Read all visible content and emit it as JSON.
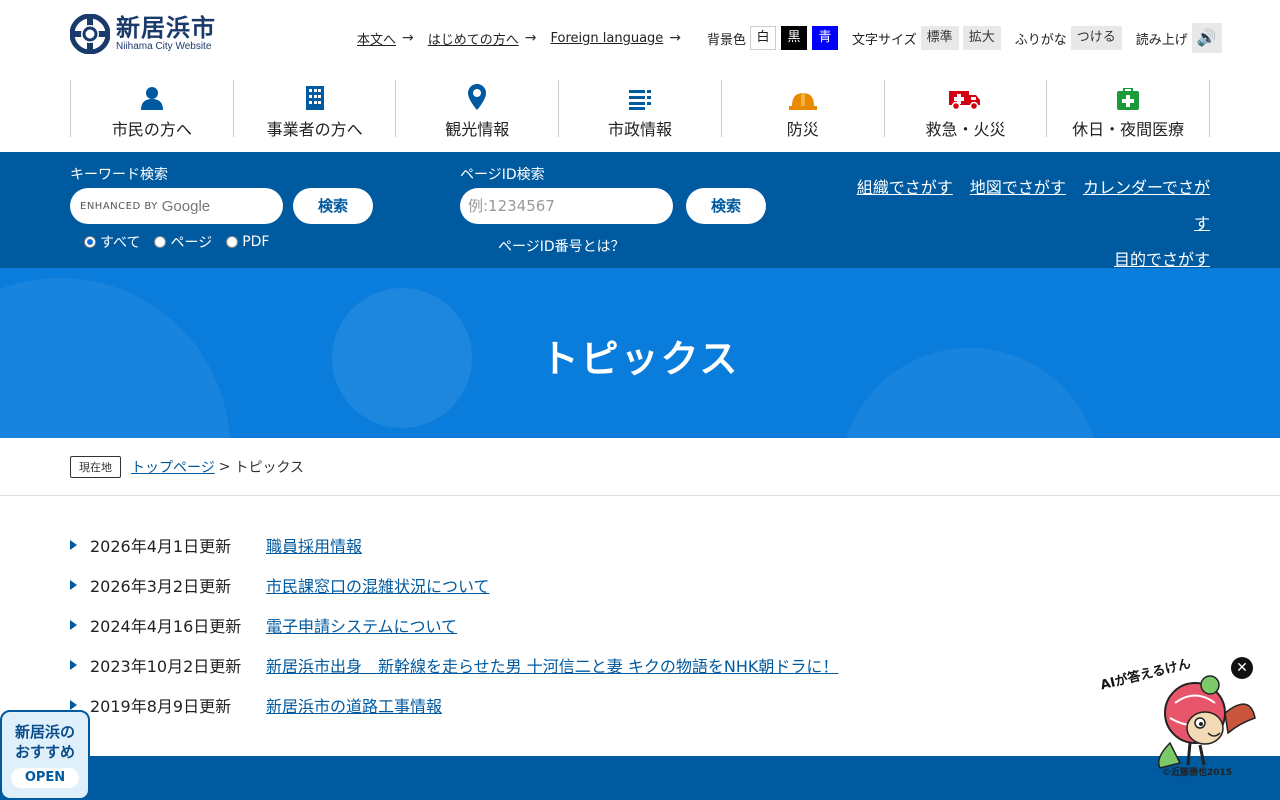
{
  "header": {
    "logo_title": "新居浜市",
    "logo_sub": "Niihama City Website",
    "links": [
      {
        "label": "本文へ"
      },
      {
        "label": "はじめての方へ"
      },
      {
        "label": "Foreign language"
      }
    ],
    "arrow": "→",
    "bg_color_label": "背景色",
    "bg_white": "白",
    "bg_black": "黒",
    "bg_blue": "青",
    "font_size_label": "文字サイズ",
    "font_standard": "標準",
    "font_large": "拡大",
    "furigana_label": "ふりがな",
    "furigana_btn": "つける",
    "read_aloud_label": "読み上げ",
    "speaker_glyph": "🔊"
  },
  "gnav": [
    {
      "label": "市民の方へ",
      "icon": "person-icon"
    },
    {
      "label": "事業者の方へ",
      "icon": "building-icon"
    },
    {
      "label": "観光情報",
      "icon": "map-pin-icon"
    },
    {
      "label": "市政情報",
      "icon": "list-icon"
    },
    {
      "label": "防災",
      "icon": "helmet-icon"
    },
    {
      "label": "救急・火災",
      "icon": "ambulance-icon"
    },
    {
      "label": "休日・夜間医療",
      "icon": "first-aid-icon"
    }
  ],
  "search": {
    "keyword_label": "キーワード検索",
    "enhanced_by": "ENHANCED BY",
    "google": "Google",
    "search_btn": "検索",
    "radios": [
      {
        "label": "すべて",
        "checked": true
      },
      {
        "label": "ページ",
        "checked": false
      },
      {
        "label": "PDF",
        "checked": false
      }
    ],
    "page_id_label": "ページID検索",
    "page_id_placeholder": "例:1234567",
    "page_id_help": "ページID番号とは？",
    "find_links": [
      "組織でさがす",
      "地図でさがす",
      "カレンダーでさがす",
      "目的でさがす"
    ]
  },
  "banner": {
    "title": "トピックス"
  },
  "breadcrumb": {
    "badge": "現在地",
    "home": "トップページ",
    "sep": ">",
    "current": "トピックス"
  },
  "topics": [
    {
      "date": "2026年4月1日更新",
      "title": "職員採用情報"
    },
    {
      "date": "2026年3月2日更新",
      "title": "市民課窓口の混雑状況について"
    },
    {
      "date": "2024年4月16日更新",
      "title": "電子申請システムについて"
    },
    {
      "date": "2023年10月2日更新",
      "title": "新居浜市出身　新幹線を走らせた男 十河信二と妻 キクの物語をNHK朝ドラに！"
    },
    {
      "date": "2019年8月9日更新",
      "title": "新居浜市の道路工事情報"
    }
  ],
  "recommend": {
    "line1": "新居浜の",
    "line2": "おすすめ",
    "open": "OPEN"
  },
  "ai": {
    "label": "AIが答えるけん",
    "close": "✕",
    "credit": "©近藤勝也2015"
  },
  "colors": {
    "brand": "#005aa0",
    "banner": "#0a7ddc",
    "navy": "#1a3a6b"
  }
}
